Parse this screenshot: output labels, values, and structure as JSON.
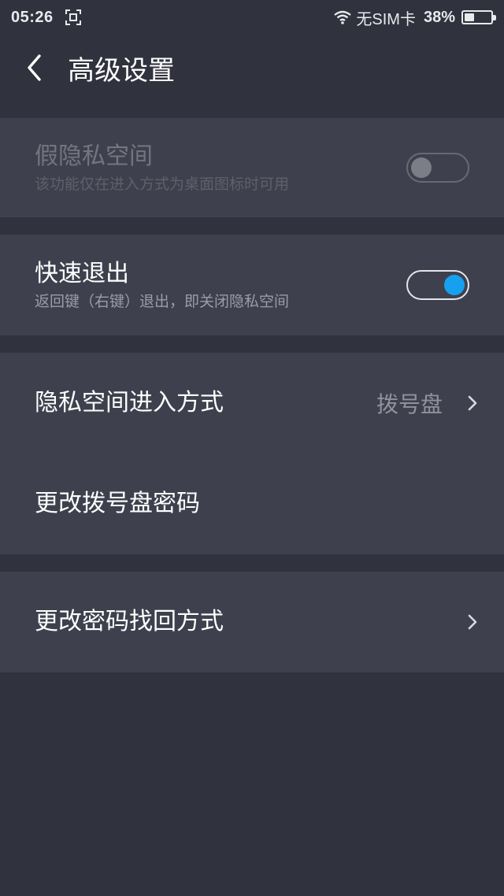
{
  "status_bar": {
    "time": "05:26",
    "sim": "无SIM卡",
    "battery_percent": "38%",
    "battery_level": 0.38,
    "icons": [
      "screenshot-icon",
      "wifi-icon",
      "battery-icon"
    ]
  },
  "header": {
    "title": "高级设置",
    "back_icon": "back-arrow-icon"
  },
  "settings": {
    "fake_space": {
      "title": "假隐私空间",
      "subtitle": "该功能仅在进入方式为桌面图标时可用",
      "enabled": false,
      "toggle_on": false
    },
    "quick_exit": {
      "title": "快速退出",
      "subtitle": "返回键（右键）退出，即关闭隐私空间",
      "toggle_on": true
    },
    "entry_method": {
      "title": "隐私空间进入方式",
      "value": "拨号盘"
    },
    "change_dial_password": {
      "title": "更改拨号盘密码"
    },
    "change_recovery": {
      "title": "更改密码找回方式"
    }
  },
  "colors": {
    "background": "#30323d",
    "card": "#3e414d",
    "accent": "#17a0ef"
  }
}
